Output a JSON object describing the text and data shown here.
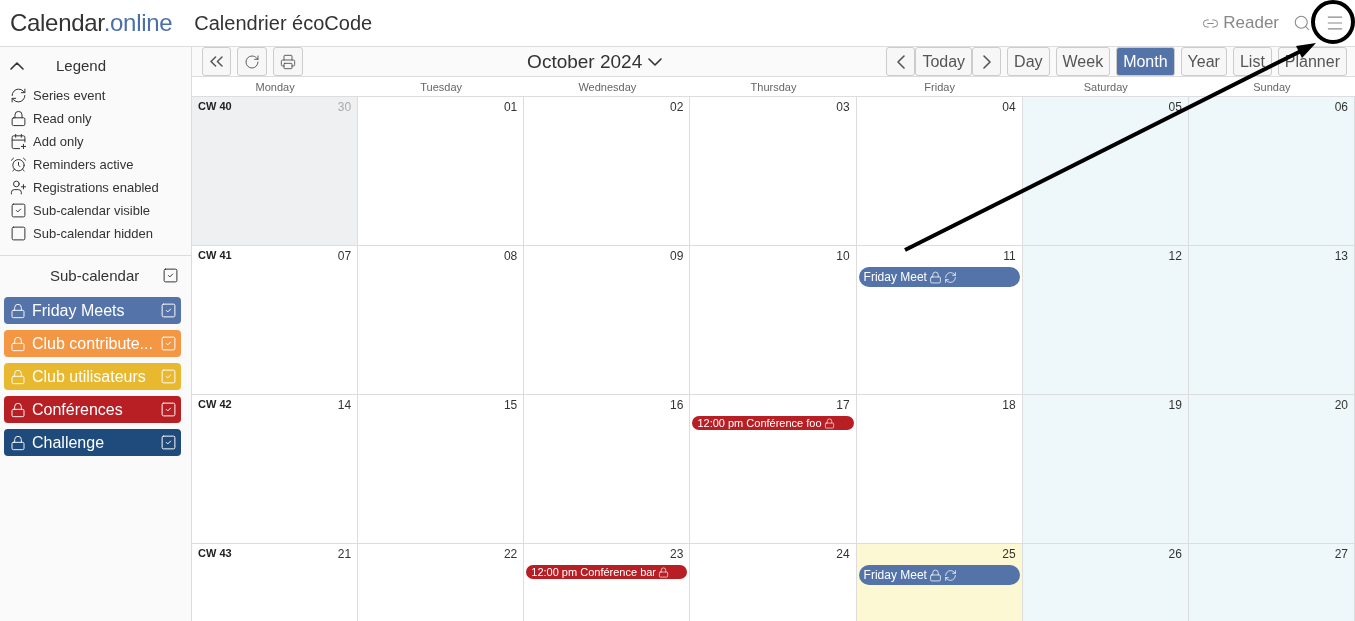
{
  "header": {
    "logo_main": "Calendar",
    "logo_accent": ".online",
    "title": "Calendrier écoCode",
    "reader": "Reader"
  },
  "legend": {
    "title": "Legend",
    "expanded": true,
    "items": [
      {
        "kind": "series",
        "label": "Series event"
      },
      {
        "kind": "lock",
        "label": "Read only"
      },
      {
        "kind": "add",
        "label": "Add only"
      },
      {
        "kind": "alarm",
        "label": "Reminders active"
      },
      {
        "kind": "register",
        "label": "Registrations enabled"
      },
      {
        "kind": "checked",
        "label": "Sub-calendar visible"
      },
      {
        "kind": "unchecked",
        "label": "Sub-calendar hidden"
      }
    ]
  },
  "subcalendars": {
    "title": "Sub-calendar",
    "checked": true,
    "items": [
      {
        "name": "Friday Meets",
        "color": "#5473a8",
        "checked": true
      },
      {
        "name": "Club contribute...",
        "color": "#f39745",
        "checked": true
      },
      {
        "name": "Club utilisateurs",
        "color": "#e8b82e",
        "checked": true
      },
      {
        "name": "Conférences",
        "color": "#b71f24",
        "checked": true
      },
      {
        "name": "Challenge",
        "color": "#1e4a7c",
        "checked": true
      }
    ]
  },
  "toolbar": {
    "month_label": "October 2024",
    "today": "Today",
    "views": [
      {
        "label": "Day",
        "selected": false
      },
      {
        "label": "Week",
        "selected": false
      },
      {
        "label": "Month",
        "selected": true
      },
      {
        "label": "Year",
        "selected": false
      },
      {
        "label": "List",
        "selected": false
      },
      {
        "label": "Planner",
        "selected": false
      }
    ]
  },
  "weekdays": [
    "Monday",
    "Tuesday",
    "Wednesday",
    "Thursday",
    "Friday",
    "Saturday",
    "Sunday"
  ],
  "weeks": [
    {
      "label": "CW 40",
      "days": [
        {
          "date": "30",
          "other_month": true
        },
        {
          "date": "01"
        },
        {
          "date": "02"
        },
        {
          "date": "03"
        },
        {
          "date": "04"
        },
        {
          "date": "05",
          "weekend": true
        },
        {
          "date": "06",
          "weekend": true
        }
      ]
    },
    {
      "label": "CW 41",
      "days": [
        {
          "date": "07"
        },
        {
          "date": "08"
        },
        {
          "date": "09"
        },
        {
          "date": "10"
        },
        {
          "date": "11",
          "events": [
            {
              "kind": "allday",
              "title": "Friday Meet",
              "color": "#5473a8",
              "locked": true,
              "series": true
            }
          ]
        },
        {
          "date": "12",
          "weekend": true
        },
        {
          "date": "13",
          "weekend": true
        }
      ]
    },
    {
      "label": "CW 42",
      "days": [
        {
          "date": "14"
        },
        {
          "date": "15"
        },
        {
          "date": "16"
        },
        {
          "date": "17",
          "events": [
            {
              "kind": "timed",
              "time": "12:00 pm",
              "title": "Conférence foo",
              "color": "#b71f24",
              "locked": true
            }
          ]
        },
        {
          "date": "18"
        },
        {
          "date": "19",
          "weekend": true
        },
        {
          "date": "20",
          "weekend": true
        }
      ]
    },
    {
      "label": "CW 43",
      "days": [
        {
          "date": "21"
        },
        {
          "date": "22"
        },
        {
          "date": "23",
          "events": [
            {
              "kind": "timed",
              "time": "12:00 pm",
              "title": "Conférence bar",
              "color": "#b71f24",
              "locked": true
            }
          ]
        },
        {
          "date": "24"
        },
        {
          "date": "25",
          "today": true,
          "events": [
            {
              "kind": "allday",
              "title": "Friday Meet",
              "color": "#5473a8",
              "locked": true,
              "series": true
            }
          ]
        },
        {
          "date": "26",
          "weekend": true
        },
        {
          "date": "27",
          "weekend": true
        }
      ]
    }
  ]
}
